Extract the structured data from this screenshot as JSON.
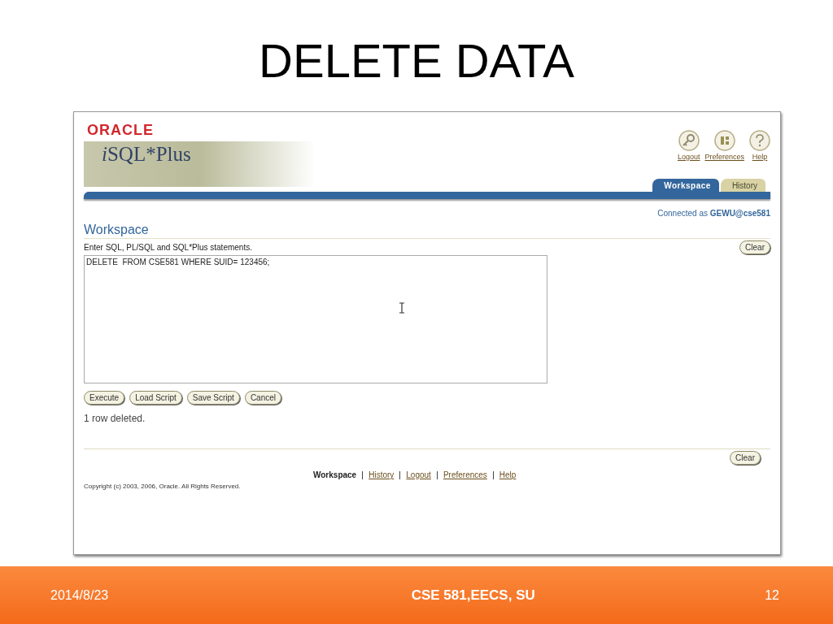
{
  "slide": {
    "title": "DELETE DATA",
    "footer": {
      "date": "2014/8/23",
      "course": "CSE 581,EECS, SU",
      "page": "12"
    }
  },
  "app": {
    "brand": "ORACLE",
    "product": "iSQL*Plus",
    "global_links": [
      {
        "label": "Logout",
        "kind": "logout"
      },
      {
        "label": "Preferences",
        "kind": "preferences"
      },
      {
        "label": "Help",
        "kind": "help"
      }
    ],
    "tabs": [
      {
        "label": "Workspace",
        "selected": true
      },
      {
        "label": "History",
        "selected": false
      }
    ],
    "connection": "Connected as **GEWU@cse581**",
    "section_title": "Workspace",
    "instructions": "Enter SQL, PL/SQL and SQL*Plus statements.",
    "clear_top": "Clear",
    "sql": "DELETE  FROM CSE581 WHERE SUID= 123456;",
    "buttons": [
      "Execute",
      "Load Script",
      "Save Script",
      "Cancel"
    ],
    "message": "1 row deleted.",
    "clear_bottom": "Clear",
    "footer_links": [
      {
        "label": "Workspace",
        "selected": true
      },
      {
        "label": "History",
        "selected": false
      },
      {
        "label": "Logout",
        "selected": false
      },
      {
        "label": "Preferences",
        "selected": false
      },
      {
        "label": "Help",
        "selected": false
      }
    ],
    "copyright": "Copyright (c) 2003, 2006, Oracle. All Rights Reserved."
  }
}
